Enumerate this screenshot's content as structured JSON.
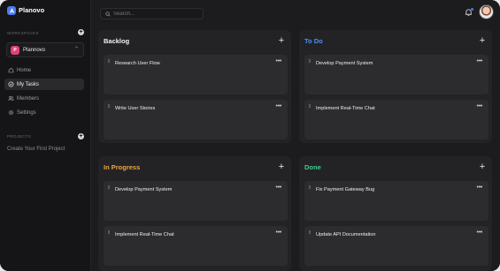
{
  "app": {
    "name": "Planovo"
  },
  "sidebar": {
    "workspaces_label": "WORKSPACES",
    "workspace": {
      "initial": "P",
      "name": "Plannovo"
    },
    "nav": [
      {
        "label": "Home",
        "icon": "home-icon"
      },
      {
        "label": "My Tasks",
        "icon": "check-circle-icon",
        "active": true
      },
      {
        "label": "Members",
        "icon": "users-icon"
      },
      {
        "label": "Settings",
        "icon": "gear-icon"
      }
    ],
    "projects_label": "PROJECTS",
    "projects_empty": "Create Your First Project"
  },
  "header": {
    "search_placeholder": "Search..."
  },
  "colors": {
    "todo": "#4a8ff7",
    "in_progress": "#f0a53c",
    "done": "#3ecf8e",
    "backlog": "#f2f2f2"
  },
  "board": {
    "columns": [
      {
        "title": "Backlog",
        "cards": [
          "Research User Flow",
          "Write User Stories"
        ]
      },
      {
        "title": "To Do",
        "cards": [
          "Develop Payment System",
          "Implement Real-Time Chat"
        ]
      },
      {
        "title": "In Progress",
        "cards": [
          "Develop Payment System",
          "Implement Real-Time Chat"
        ]
      },
      {
        "title": "Done",
        "cards": [
          "Fix Payment Gateway Bug",
          "Update API Documentation"
        ]
      }
    ]
  }
}
